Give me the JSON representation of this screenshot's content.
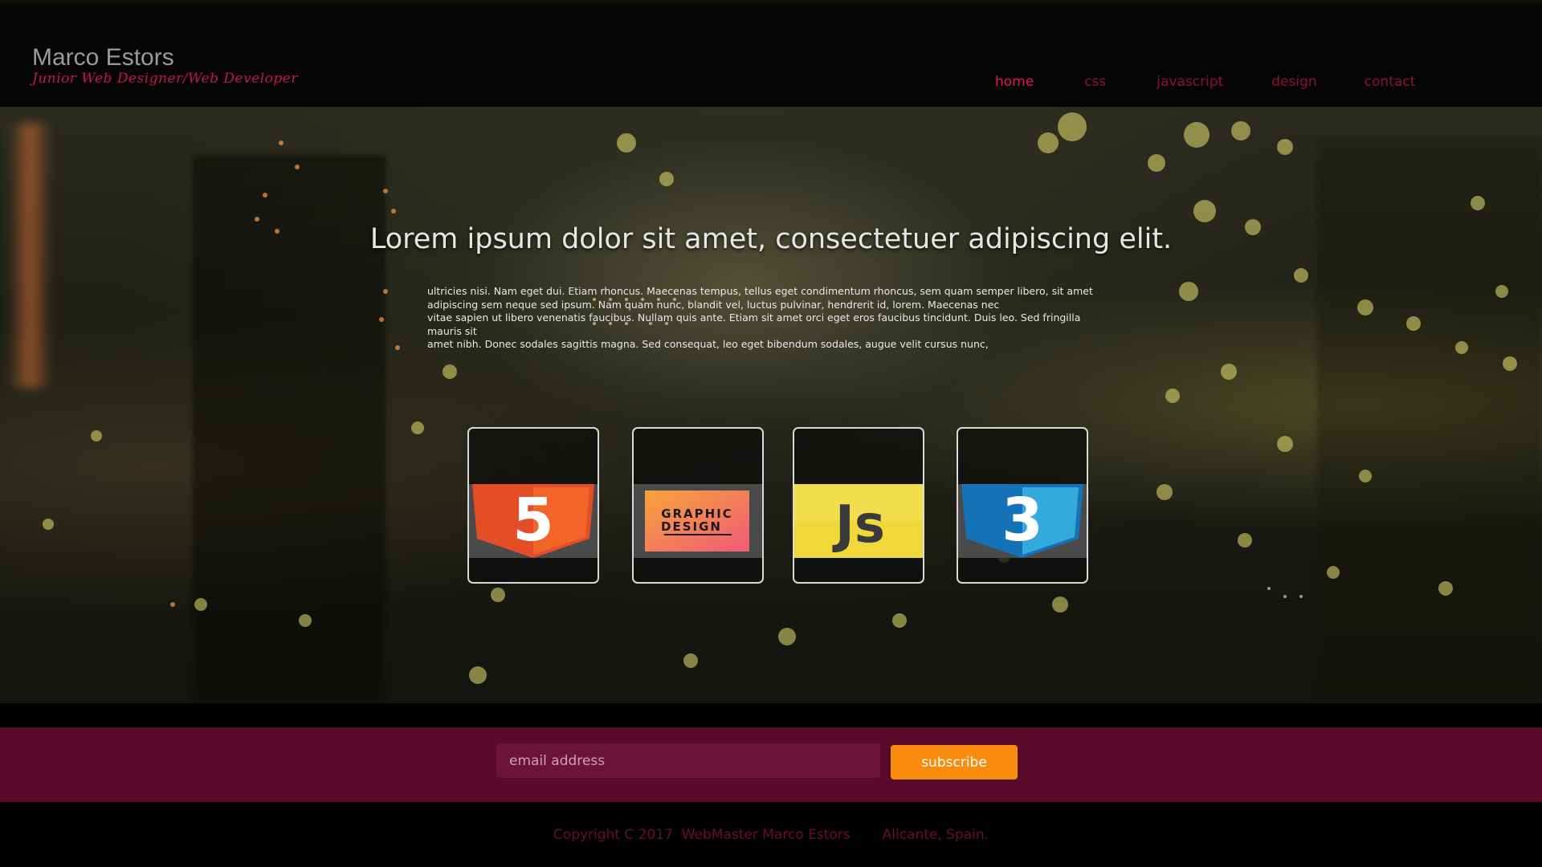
{
  "header": {
    "name": "Marco Estors",
    "tagline": "Junior Web Designer/Web Developer"
  },
  "nav": {
    "items": [
      {
        "label": "home",
        "active": true
      },
      {
        "label": "css",
        "active": false
      },
      {
        "label": "javascript",
        "active": false
      },
      {
        "label": "design",
        "active": false
      },
      {
        "label": "contact",
        "active": false
      }
    ]
  },
  "hero": {
    "title": "Lorem ipsum dolor sit amet, consectetuer adipiscing elit.",
    "body_lines": [
      "ultricies nisi. Nam eget dui. Etiam rhoncus. Maecenas tempus, tellus eget condimentum rhoncus, sem quam semper libero, sit amet",
      "adipiscing sem neque sed ipsum. Nam quam nunc, blandit vel, luctus pulvinar, hendrerit id, lorem. Maecenas nec",
      "vitae sapien ut libero venenatis faucibus. Nullam quis ante. Etiam sit amet orci eget eros faucibus tincidunt. Duis leo. Sed fringilla mauris sit",
      "amet nibh. Donec sodales sagittis magna. Sed consequat, leo eget bibendum sodales, augue velit cursus nunc,"
    ]
  },
  "cards": [
    {
      "icon": "html5-icon",
      "glyph": "5",
      "color": "#e44d26"
    },
    {
      "icon": "graphic-design-icon",
      "line1": "GRAPHIC",
      "line2": "DESIGN"
    },
    {
      "icon": "javascript-icon",
      "glyph": "Js",
      "color": "#f0d83a"
    },
    {
      "icon": "css3-icon",
      "glyph": "3",
      "color": "#1b73ba"
    }
  ],
  "subscribe": {
    "placeholder": "email address",
    "button_label": "subscribe"
  },
  "footer": {
    "copyright": "Copyright C 2017  WebMaster Marco Estors",
    "location": "Alicante, Spain."
  },
  "colors": {
    "accent": "#e2155a",
    "nav": "#8e1038",
    "band": "#5b0b2a",
    "button": "#f98b0f"
  }
}
